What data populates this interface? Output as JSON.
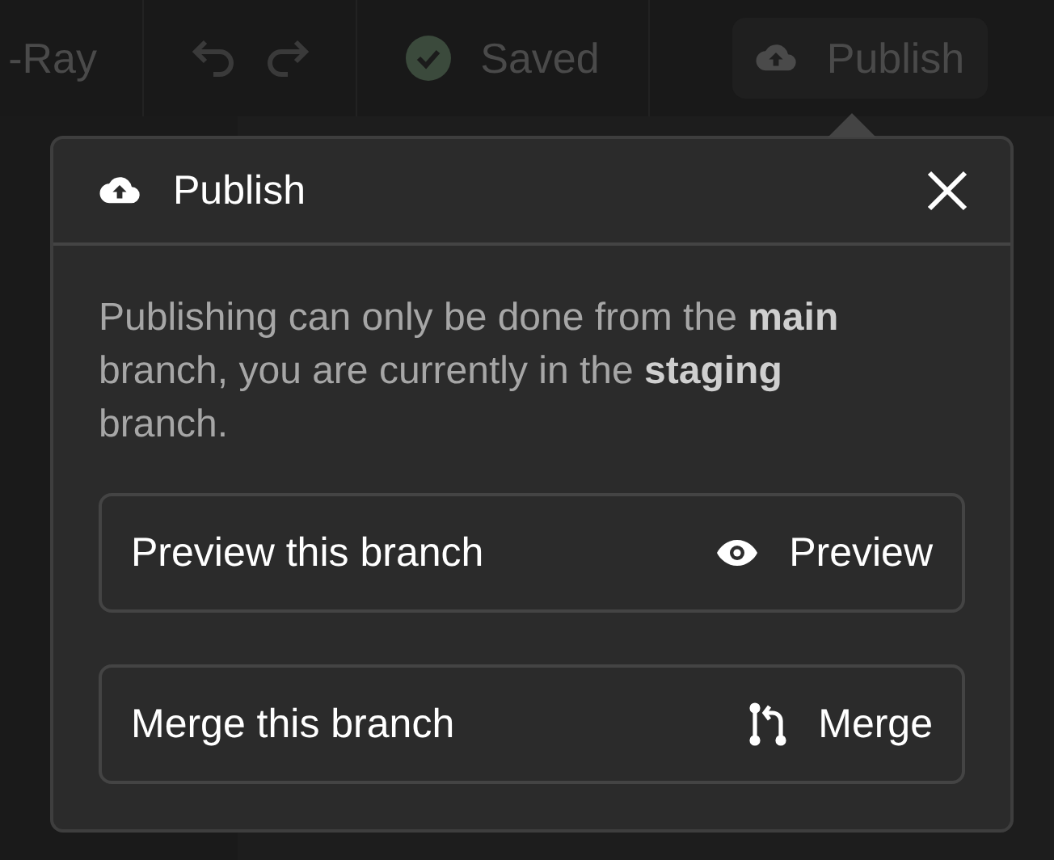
{
  "toolbar": {
    "title": "-Ray",
    "status": "Saved",
    "publish_label": "Publish"
  },
  "popover": {
    "title": "Publish",
    "message": "Publishing can only be done from the **main** branch, you are currently in the **staging** branch.",
    "actions": [
      {
        "kind": "preview",
        "label": "Preview this branch",
        "button": "Preview"
      },
      {
        "kind": "merge",
        "label": "Merge this branch",
        "button": "Merge"
      }
    ]
  }
}
